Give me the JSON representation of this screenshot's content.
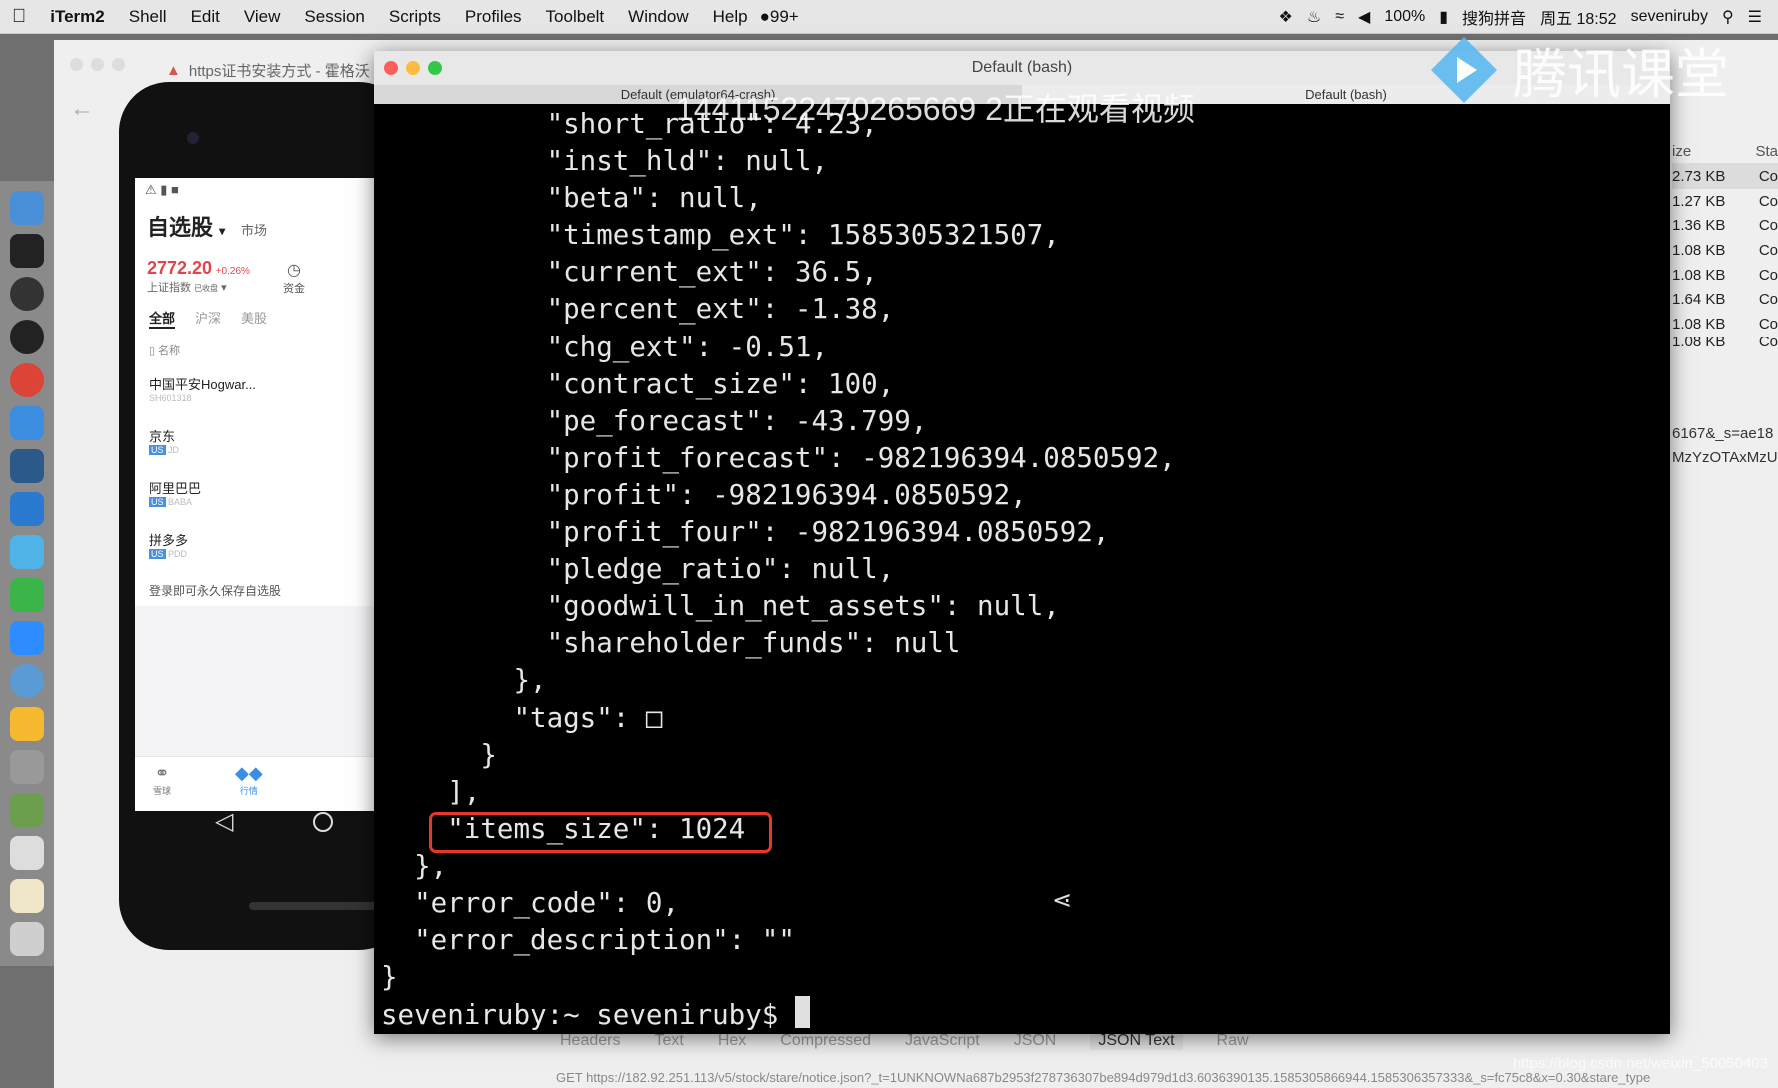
{
  "menubar": {
    "app": "iTerm2",
    "items": [
      "Shell",
      "Edit",
      "View",
      "Session",
      "Scripts",
      "Profiles",
      "Toolbelt",
      "Window",
      "Help"
    ],
    "status": {
      "notifications": "99+",
      "battery": "100%",
      "input_method": "搜狗拼音",
      "clock": "周五 18:52",
      "user": "seveniruby"
    }
  },
  "browser": {
    "tab_title": "https证书安装方式 - 霍格沃",
    "size_header": "ize",
    "status_header": "Sta",
    "sizes": [
      "2.73 KB",
      "1.27 KB",
      "1.36 KB",
      "1.08 KB",
      "1.08 KB",
      "1.64 KB",
      "1.08 KB",
      "1.08 KB"
    ],
    "status_cell": "Co",
    "url_fragments": [
      "6167&_s=ae18",
      "MzYzOTAxMzU"
    ],
    "bottom_tabs": [
      "Headers",
      "Text",
      "Hex",
      "Compressed",
      "JavaScript",
      "JSON",
      "JSON Text",
      "Raw"
    ],
    "active_tab": "JSON Text",
    "request_line": "GET https://182.92.251.113/v5/stock/stare/notice.json?_t=1UNKNOWNa687b2953f278736307be894d979d1d3.6036390135.1585305866944.1585306357333&_s=fc75c8&x=0.30&stare_type",
    "watermark": "https://blog.csdn.net/weixin_50050403"
  },
  "phone": {
    "title": "自选股",
    "market_tab": "市场",
    "index_value": "2772.20",
    "index_change": "+0.26%",
    "index_name": "上证指数",
    "index_status": "已收盘",
    "fund_label": "资金",
    "filters": [
      "全部",
      "沪深",
      "美股"
    ],
    "name_header": "名称",
    "stocks": [
      {
        "name": "中国平安Hogwar...",
        "code": "SH601318",
        "market": ""
      },
      {
        "name": "京东",
        "code": "JD",
        "market": "US"
      },
      {
        "name": "阿里巴巴",
        "code": "BABA",
        "market": "US"
      },
      {
        "name": "拼多多",
        "code": "PDD",
        "market": "US"
      }
    ],
    "login_hint": "登录即可永久保存自选股",
    "bottom_nav": [
      "雪球",
      "行情"
    ],
    "accent": "#e0474c"
  },
  "terminal": {
    "window_title": "Default (bash)",
    "tabs": [
      "Default (emulator64-crash)",
      "Default (bash)"
    ],
    "lines": [
      "          \"short_ratio\": 4.23,",
      "          \"inst_hld\": null,",
      "          \"beta\": null,",
      "          \"timestamp_ext\": 1585305321507,",
      "          \"current_ext\": 36.5,",
      "          \"percent_ext\": -1.38,",
      "          \"chg_ext\": -0.51,",
      "          \"contract_size\": 100,",
      "          \"pe_forecast\": -43.799,",
      "          \"profit_forecast\": -982196394.0850592,",
      "          \"profit\": -982196394.0850592,",
      "          \"profit_four\": -982196394.0850592,",
      "          \"pledge_ratio\": null,",
      "          \"goodwill_in_net_assets\": null,",
      "          \"shareholder_funds\": null",
      "        },",
      "        \"tags\": □",
      "      }",
      "    ],",
      "    \"items_size\": 1024",
      "  },",
      "  \"error_code\": 0,",
      "  \"error_description\": \"\"",
      "}"
    ],
    "prompt": "seveniruby:~ seveniruby$ ",
    "highlight_color": "#e8372a"
  },
  "overlay": {
    "viewer_watermark": "14411522470265669 2正在观看视频",
    "brand": "腾讯课堂"
  }
}
